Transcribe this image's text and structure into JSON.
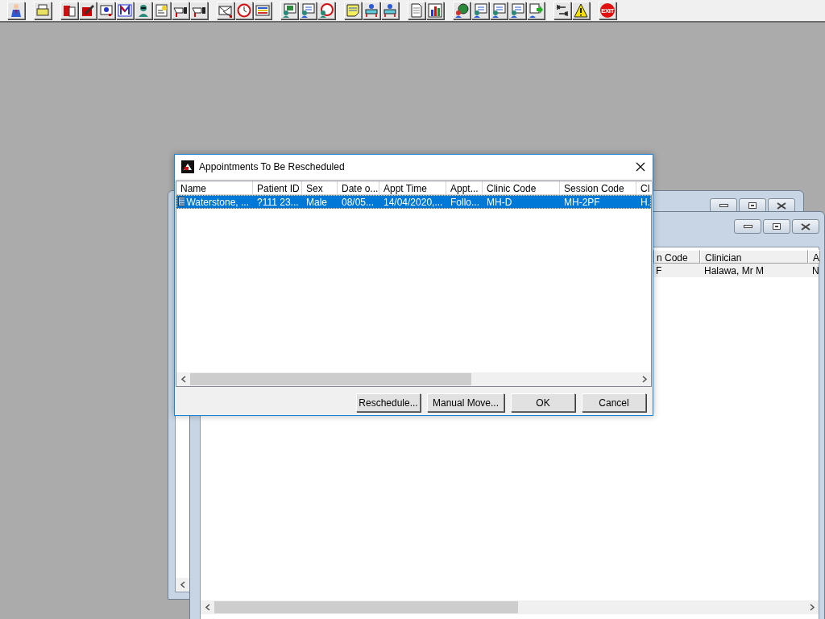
{
  "toolbar": {
    "groups": [
      [
        {
          "kind": "person"
        }
      ],
      [
        {
          "kind": "printer"
        }
      ],
      [
        {
          "kind": "book"
        },
        {
          "kind": "pen"
        },
        {
          "kind": "card"
        },
        {
          "kind": "zigzag"
        },
        {
          "kind": "doctor"
        },
        {
          "kind": "note"
        },
        {
          "kind": "hand"
        },
        {
          "kind": "hand"
        }
      ],
      [
        {
          "kind": "envelope"
        },
        {
          "kind": "clock"
        },
        {
          "kind": "list"
        }
      ],
      [
        {
          "kind": "monitor"
        },
        {
          "kind": "form"
        },
        {
          "kind": "dial"
        }
      ],
      [
        {
          "kind": "sticky"
        },
        {
          "kind": "bed"
        },
        {
          "kind": "bed"
        }
      ],
      [
        {
          "kind": "document"
        },
        {
          "kind": "bars"
        }
      ],
      [
        {
          "kind": "globe"
        },
        {
          "kind": "form"
        },
        {
          "kind": "form"
        },
        {
          "kind": "form"
        },
        {
          "kind": "arrow"
        }
      ],
      [
        {
          "kind": "indent"
        },
        {
          "kind": "warning"
        }
      ],
      [
        {
          "kind": "exit",
          "label": "EXIT"
        }
      ]
    ]
  },
  "back_window": {
    "table": {
      "columns": [
        {
          "label": "n Code"
        },
        {
          "label": "Clinician"
        },
        {
          "label": "A"
        }
      ],
      "rows": [
        {
          "cells": [
            "F",
            "Halawa, Mr M",
            "N"
          ],
          "selected": true
        }
      ]
    }
  },
  "dialog": {
    "title": "Appointments To Be Rescheduled",
    "columns": [
      {
        "label": "Name"
      },
      {
        "label": "Patient ID"
      },
      {
        "label": "Sex"
      },
      {
        "label": "Date o..."
      },
      {
        "label": "Appt Time"
      },
      {
        "label": "Appt..."
      },
      {
        "label": "Clinic Code"
      },
      {
        "label": "Session Code"
      },
      {
        "label": "Cl"
      }
    ],
    "rows": [
      {
        "cells": [
          "Waterstone, ...",
          "?111 23...",
          "Male",
          "08/05...",
          "14/04/2020,...",
          "Follo...",
          "MH-D",
          "MH-2PF",
          "H."
        ],
        "selected": true
      }
    ],
    "buttons": [
      {
        "label": "Reschedule..."
      },
      {
        "label": "Manual Move..."
      },
      {
        "label": "OK"
      },
      {
        "label": "Cancel"
      }
    ]
  }
}
